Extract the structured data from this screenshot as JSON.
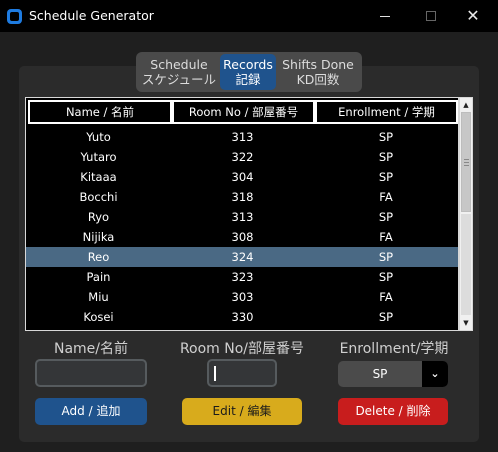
{
  "window": {
    "title": "Schedule Generator",
    "minimize_glyph": "—",
    "maximize_glyph": "☐",
    "close_glyph": "✕"
  },
  "tabs": [
    {
      "line1": "Schedule",
      "line2": "スケジュール",
      "active": false
    },
    {
      "line1": "Records",
      "line2": "記録",
      "active": true
    },
    {
      "line1": "Shifts Done",
      "line2": "KD回数",
      "active": false
    }
  ],
  "table": {
    "columns": [
      "Name / 名前",
      "Room No / 部屋番号",
      "Enrollment / 学期"
    ],
    "rows": [
      [
        "Yuto",
        "313",
        "SP"
      ],
      [
        "Yutaro",
        "322",
        "SP"
      ],
      [
        "Kitaaa",
        "304",
        "SP"
      ],
      [
        "Bocchi",
        "318",
        "FA"
      ],
      [
        "Ryo",
        "313",
        "SP"
      ],
      [
        "Nijika",
        "308",
        "FA"
      ],
      [
        "Reo",
        "324",
        "SP"
      ],
      [
        "Pain",
        "323",
        "SP"
      ],
      [
        "Miu",
        "303",
        "FA"
      ],
      [
        "Kosei",
        "330",
        "SP"
      ]
    ],
    "selected_row_index": 6
  },
  "scrollbar": {
    "up_glyph": "▲",
    "down_glyph": "▼"
  },
  "form": {
    "name_label": "Name/名前",
    "name_value": "",
    "room_label": "Room No/部屋番号",
    "room_value": "",
    "enrollment_label": "Enrollment/学期",
    "enrollment_value": "SP",
    "dropdown_glyph": "⌄"
  },
  "buttons": {
    "add": "Add / 追加",
    "edit": "Edit / 編集",
    "delete": "Delete / 削除"
  },
  "colors": {
    "accent_blue": "#1f538d",
    "selected_row": "#4a6984",
    "edit_yellow": "#d8ab1c",
    "delete_red": "#c81d1d"
  }
}
